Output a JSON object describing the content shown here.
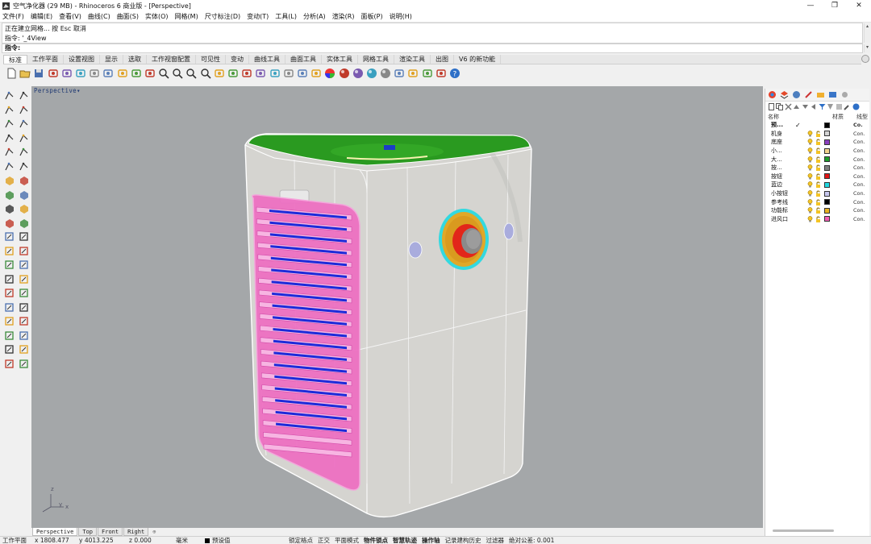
{
  "window": {
    "title": "空气净化器 (29 MB) - Rhinoceros 6 商业版 - [Perspective]",
    "controls": [
      "—",
      "❐",
      "✕"
    ]
  },
  "menu": [
    "文件(F)",
    "编辑(E)",
    "查看(V)",
    "曲线(C)",
    "曲面(S)",
    "实体(O)",
    "网格(M)",
    "尺寸标注(D)",
    "变动(T)",
    "工具(L)",
    "分析(A)",
    "渲染(R)",
    "面板(P)",
    "说明(H)"
  ],
  "command_history": [
    "正在建立网格... 按 Esc 取消",
    "指令: '_4View"
  ],
  "command_prompt": "指令:",
  "toolbar_tabs": [
    "标准",
    "工作平面",
    "设置视图",
    "显示",
    "选取",
    "工作视窗配置",
    "可见性",
    "变动",
    "曲线工具",
    "曲面工具",
    "实体工具",
    "网格工具",
    "渲染工具",
    "出图",
    "V6 的新功能"
  ],
  "active_toolbar_tab": "标准",
  "toolbar_icons": [
    "new-icon",
    "open-icon",
    "save-icon",
    "print-icon",
    "import-icon",
    "cut-icon",
    "copy-icon",
    "paste-icon",
    "undo-icon",
    "pan-icon",
    "rotate-view-icon",
    "zoom-icon",
    "zoom-window-icon",
    "zoom-extents-icon",
    "zoom-selected-icon",
    "rotate-3d-icon",
    "four-view-icon",
    "select-icon",
    "ruler-icon",
    "snap-icon",
    "light-icon",
    "lock-icon",
    "layer-icon",
    "color-wheel-icon",
    "shaded-sphere-icon",
    "rendered-sphere-icon",
    "ghosted-sphere-icon",
    "xray-sphere-icon",
    "magic-wand-icon",
    "gear-options-icon",
    "grid-icon",
    "render-icon",
    "help-icon"
  ],
  "viewport": {
    "title": "Perspective",
    "tabs": [
      "Perspective",
      "Top",
      "Front",
      "Right"
    ],
    "active_tab": "Perspective",
    "add_tab": "⊕",
    "axis_labels": [
      "z",
      "y",
      "x"
    ]
  },
  "layers_panel": {
    "headers": {
      "name": "名称",
      "material": "材质",
      "linetype": "线型"
    },
    "layers": [
      {
        "name": "预...",
        "checked": true,
        "color": "#000000",
        "linetype": "Co.",
        "current": true,
        "icons": false
      },
      {
        "name": "机身",
        "color": "#d4d4d4",
        "linetype": "Con."
      },
      {
        "name": "底座",
        "color": "#8b3fbf",
        "linetype": "Con."
      },
      {
        "name": "小...",
        "color": "#f2d28c",
        "linetype": "Con."
      },
      {
        "name": "大...",
        "color": "#1e9e2a",
        "linetype": "Con."
      },
      {
        "name": "按...",
        "color": "#808080",
        "linetype": "Con."
      },
      {
        "name": "按钮",
        "color": "#e01515",
        "linetype": "Con."
      },
      {
        "name": "蓝边",
        "color": "#22d8e0",
        "linetype": "Con."
      },
      {
        "name": "小按钮",
        "color": "#c8c8ee",
        "linetype": "Con."
      },
      {
        "name": "参考线",
        "color": "#000000",
        "linetype": "Con."
      },
      {
        "name": "功能标",
        "color": "#e8b020",
        "linetype": "Con."
      },
      {
        "name": "进风口",
        "color": "#f25cb4",
        "linetype": "Con."
      }
    ]
  },
  "status": {
    "cplane": "工作平面",
    "x": "x 1808.477",
    "y": "y 4013.225",
    "z": "z 0.000",
    "units": "毫米",
    "layer": "预设值",
    "grid_snap": "锁定格点",
    "ortho": "正交",
    "planar": "平面模式",
    "osnap": "物件锁点",
    "smarttrack": "智慧轨迹",
    "gumball": "操作轴",
    "history": "记录建构历史",
    "filter": "过滤器",
    "tolerance": "绝对公差: 0.001"
  }
}
